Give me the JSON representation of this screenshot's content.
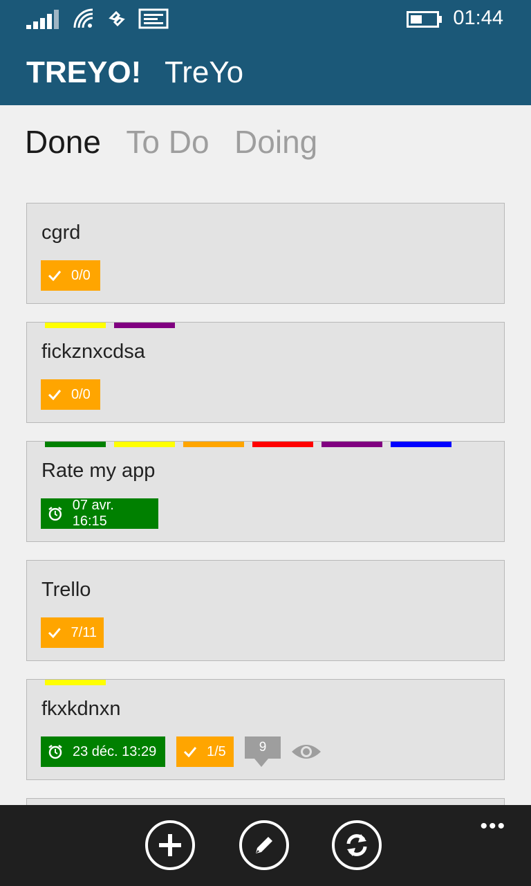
{
  "status": {
    "time": "01:44"
  },
  "app": {
    "logo": "TREYO!",
    "board_name": "TreYo"
  },
  "tabs": [
    {
      "label": "Done",
      "active": true
    },
    {
      "label": "To Do",
      "active": false
    },
    {
      "label": "Doing",
      "active": false
    }
  ],
  "label_colors": {
    "yellow": "#ffff00",
    "purple": "#800080",
    "green": "#008000",
    "orange": "#ffa500",
    "red": "#ff0000",
    "blue": "#0000ff"
  },
  "cards": [
    {
      "title": "cgrd",
      "labels": [],
      "checklist": "0/0"
    },
    {
      "title": "fickznxcdsa",
      "labels": [
        "yellow",
        "purple"
      ],
      "checklist": "0/0"
    },
    {
      "title": "Rate my app",
      "labels": [
        "green",
        "yellow",
        "orange",
        "red",
        "purple",
        "blue"
      ],
      "due": "07 avr. 16:15"
    },
    {
      "title": "Trello",
      "labels": [],
      "checklist": "7/11"
    },
    {
      "title": "fkxkdnxn",
      "labels": [
        "yellow"
      ],
      "due": "23 déc. 13:29",
      "checklist": "1/5",
      "comments": "9",
      "watching": true
    }
  ],
  "appbar_buttons": [
    {
      "icon": "add-icon"
    },
    {
      "icon": "edit-icon"
    },
    {
      "icon": "refresh-icon"
    }
  ],
  "more_label": "•••"
}
